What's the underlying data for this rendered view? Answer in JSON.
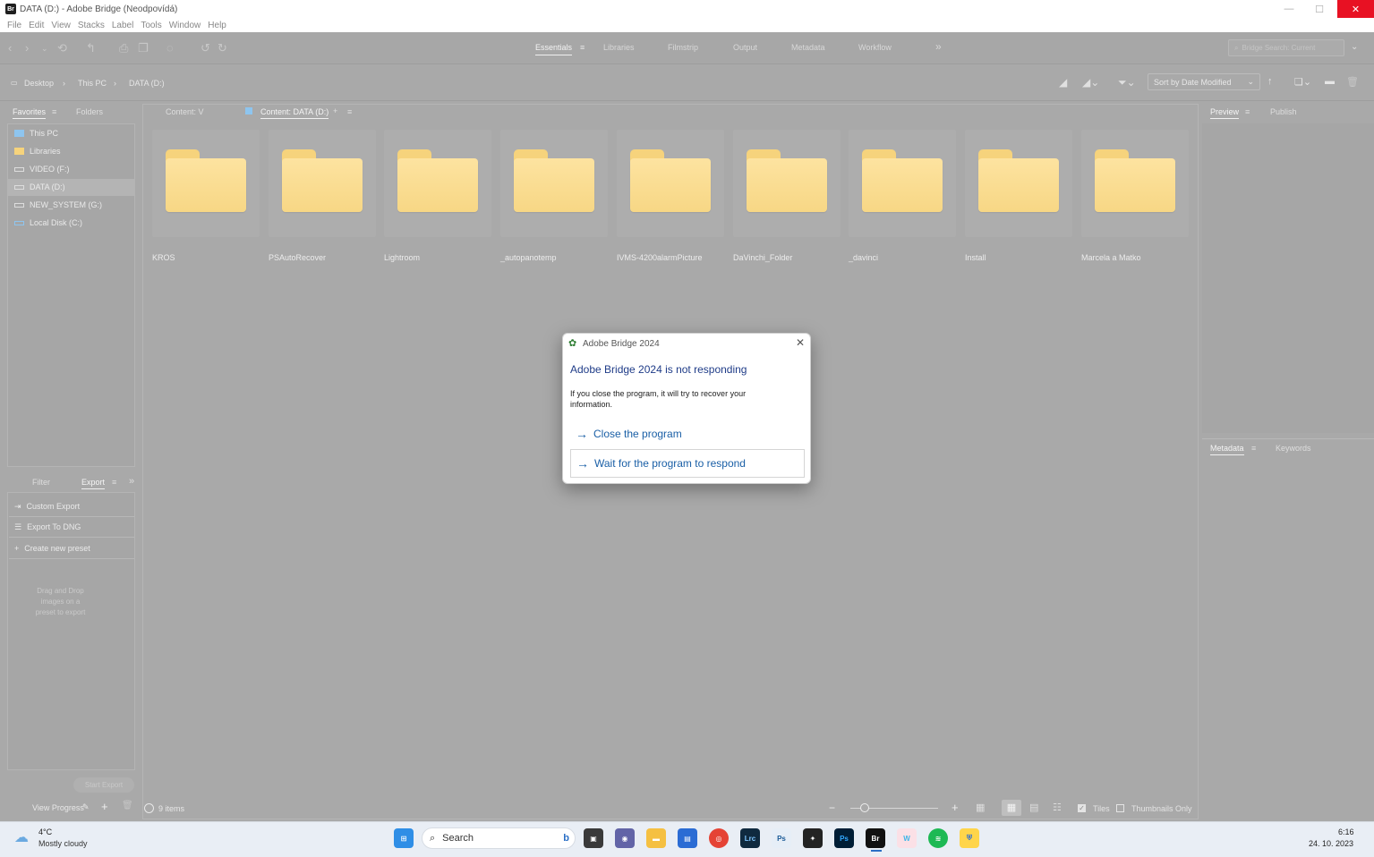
{
  "window": {
    "app_icon": "Br",
    "title": "DATA (D:) - Adobe Bridge (Neodpovídá)",
    "controls": {
      "minimize": "—",
      "maximize": "☐",
      "close": "✕"
    }
  },
  "menu": [
    "File",
    "Edit",
    "View",
    "Stacks",
    "Label",
    "Tools",
    "Window",
    "Help"
  ],
  "workspaces": {
    "tabs": [
      "Essentials",
      "Libraries",
      "Filmstrip",
      "Output",
      "Metadata",
      "Workflow"
    ],
    "active": "Essentials",
    "more": "»"
  },
  "search": {
    "placeholder": "Bridge Search: Current"
  },
  "breadcrumb": [
    "Desktop",
    "This PC",
    "DATA (D:)"
  ],
  "sort": {
    "label": "Sort by Date Modified"
  },
  "left_panel": {
    "tabs": [
      "Favorites",
      "Folders"
    ],
    "favorites": [
      {
        "label": "This PC",
        "icon": "computer-icon"
      },
      {
        "label": "Libraries",
        "icon": "folder-icon"
      },
      {
        "label": "VIDEO (F:)",
        "icon": "drive-icon"
      },
      {
        "label": "DATA (D:)",
        "icon": "drive-icon"
      },
      {
        "label": "NEW_SYSTEM (G:)",
        "icon": "drive-icon"
      },
      {
        "label": "Local Disk (C:)",
        "icon": "drive-icon"
      }
    ],
    "lower_tabs": [
      "Filter",
      "Export"
    ],
    "export_items": [
      {
        "label": "Custom Export",
        "icon": "export-icon"
      },
      {
        "label": "Export To DNG",
        "icon": "list-icon"
      },
      {
        "label": "Create new preset",
        "icon": "plus-icon"
      }
    ],
    "drop_hint": [
      "Drag and Drop",
      "images on a",
      "preset to export"
    ],
    "start_export": "Start Export",
    "view_progress": "View Progress"
  },
  "content": {
    "tabs": [
      "Content: V",
      "Content: DATA (D:)"
    ],
    "folders": [
      "KROS",
      "PSAutoRecover",
      "Lightroom",
      "_autopanotemp",
      "IVMS-4200alarmPicture",
      "DaVinchi_Folder",
      "_davinci",
      "Install",
      "Marcela a Matko"
    ],
    "item_count": "9 items",
    "view_options": {
      "tiles": "Tiles",
      "thumbnails_only": "Thumbnails Only"
    }
  },
  "right_panel": {
    "top_tabs": [
      "Preview",
      "Publish"
    ],
    "bottom_tabs": [
      "Metadata",
      "Keywords"
    ]
  },
  "dialog": {
    "title": "Adobe Bridge 2024",
    "heading": "Adobe Bridge 2024 is not responding",
    "message": "If you close the program, it will try to recover your information.",
    "options": [
      "Close the program",
      "Wait for the program to respond"
    ]
  },
  "taskbar": {
    "weather": {
      "temp": "4°C",
      "desc": "Mostly cloudy"
    },
    "search": "Search",
    "time": "6:16",
    "date": "24. 10. 2023"
  }
}
